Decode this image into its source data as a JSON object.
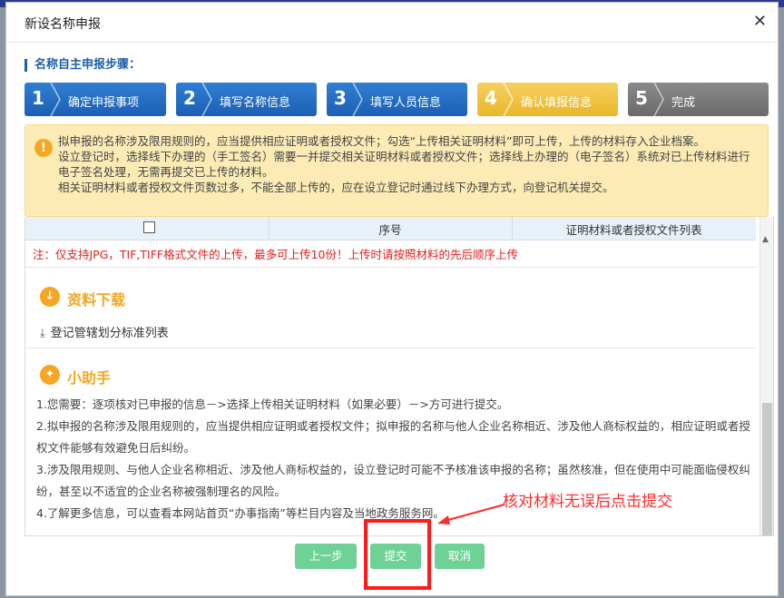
{
  "dialog": {
    "title": "新设名称申报"
  },
  "steps": {
    "label": "名称自主申报步骤：",
    "items": [
      {
        "num": "1",
        "label": "确定申报事项"
      },
      {
        "num": "2",
        "label": "填写名称信息"
      },
      {
        "num": "3",
        "label": "填写人员信息"
      },
      {
        "num": "4",
        "label": "确认填报信息"
      },
      {
        "num": "5",
        "label": "完成"
      }
    ]
  },
  "notice": {
    "line1": "拟申报的名称涉及限用规则的，应当提供相应证明或者授权文件；勾选“上传相关证明材料”即可上传，上传的材料存入企业档案。",
    "line2": "设立登记时，选择线下办理的（手工签名）需要一并提交相关证明材料或者授权文件；选择线上办理的（电子签名）系统对已上传材料进行电子签名处理，无需再提交已上传的材料。",
    "line3": "相关证明材料或者授权文件页数过多，不能全部上传的，应在设立登记时通过线下办理方式，向登记机关提交。"
  },
  "table": {
    "col_seq": "序号",
    "col_files": "证明材料或者授权文件列表",
    "note": "注：仅支持JPG，TIF,TIFF格式文件的上传，最多可上传10份！上传时请按照材料的先后顺序上传"
  },
  "download": {
    "title": "资料下载",
    "item": "登记管辖划分标准列表"
  },
  "helper": {
    "title": "小助手",
    "items": [
      "1.您需要：逐项核对已申报的信息－>选择上传相关证明材料（如果必要）－>方可进行提交。",
      "2.拟申报的名称涉及限用规则的，应当提供相应证明或者授权文件；拟申报的名称与他人企业名称相近、涉及他人商标权益的，相应证明或者授权文件能够有效避免日后纠纷。",
      "3.涉及限用规则、与他人企业名称相近、涉及他人商标权益的，设立登记时可能不予核准该申报的名称；虽然核准，但在使用中可能面临侵权纠纷，甚至以不适宜的企业名称被强制理名的风险。",
      "4.了解更多信息，可以查看本网站首页“办事指南”等栏目内容及当地政务服务网。"
    ]
  },
  "buttons": {
    "prev": "上一步",
    "submit": "提交",
    "cancel": "取消"
  },
  "annotation": {
    "text": "核对材料无误后点击提交"
  },
  "colors": {
    "blue": "#1c5fb3",
    "yellow": "#eab62a",
    "green": "#6ed196",
    "red": "#ff1b1b"
  },
  "icons": {
    "close": "close-icon",
    "warn": "warning-icon",
    "download": "download-icon",
    "bulb": "lightbulb-icon"
  }
}
